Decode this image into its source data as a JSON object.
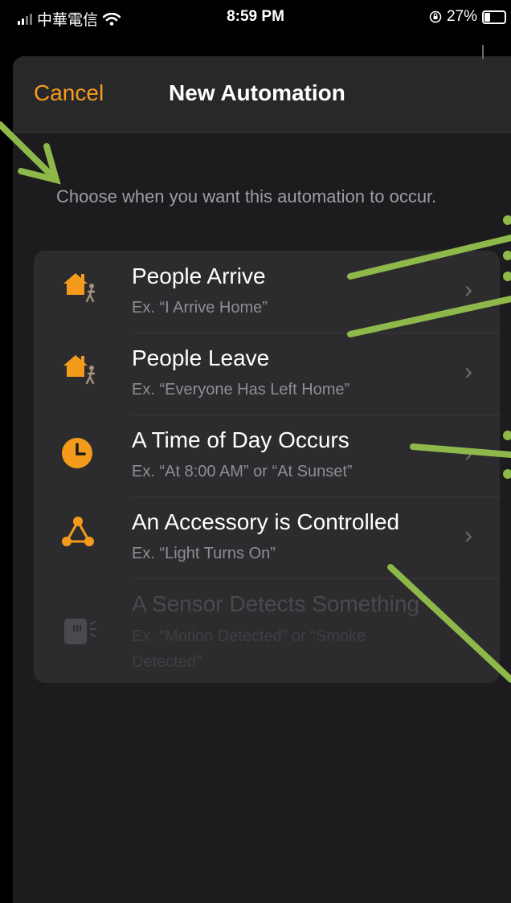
{
  "status_bar": {
    "carrier": "中華電信",
    "time": "8:59 PM",
    "battery": "27%",
    "battery_level": 0.27
  },
  "nav": {
    "cancel_label": "Cancel",
    "title": "New Automation"
  },
  "hint": "Choose when you want this automation to occur.",
  "options": [
    {
      "title": "People Arrive",
      "subtitle": "Ex. “I Arrive Home”",
      "icon": "home-person-icon",
      "enabled": true
    },
    {
      "title": "People Leave",
      "subtitle": "Ex. “Everyone Has Left Home”",
      "icon": "home-person-icon",
      "enabled": true
    },
    {
      "title": "A Time of Day Occurs",
      "subtitle": "Ex. “At 8:00 AM” or “At Sunset”",
      "icon": "clock-icon",
      "enabled": true
    },
    {
      "title": "An Accessory is Controlled",
      "subtitle": "Ex. “Light Turns On”",
      "icon": "accessory-nodes-icon",
      "enabled": true
    },
    {
      "title": "A Sensor Detects Something",
      "subtitle": "Ex. “Motion Detected” or “Smoke Detected”",
      "icon": "sensor-icon",
      "enabled": false
    }
  ],
  "colors": {
    "accent": "#f59b1c",
    "annotation": "#8fb84a",
    "background": "#1c1c1e"
  }
}
